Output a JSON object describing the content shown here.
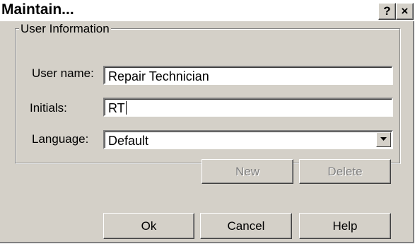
{
  "window": {
    "title": "Maintain...",
    "help_glyph": "?",
    "close_glyph": "×"
  },
  "user_info": {
    "group_label": "User Information",
    "user_name_label": "User name:",
    "user_name_value": "Repair Technician",
    "initials_label": "Initials:",
    "initials_value": "RT",
    "language_label": "Language:",
    "language_value": "Default",
    "new_label": "New",
    "delete_label": "Delete"
  },
  "footer": {
    "ok_label": "Ok",
    "cancel_label": "Cancel",
    "help_label": "Help"
  }
}
